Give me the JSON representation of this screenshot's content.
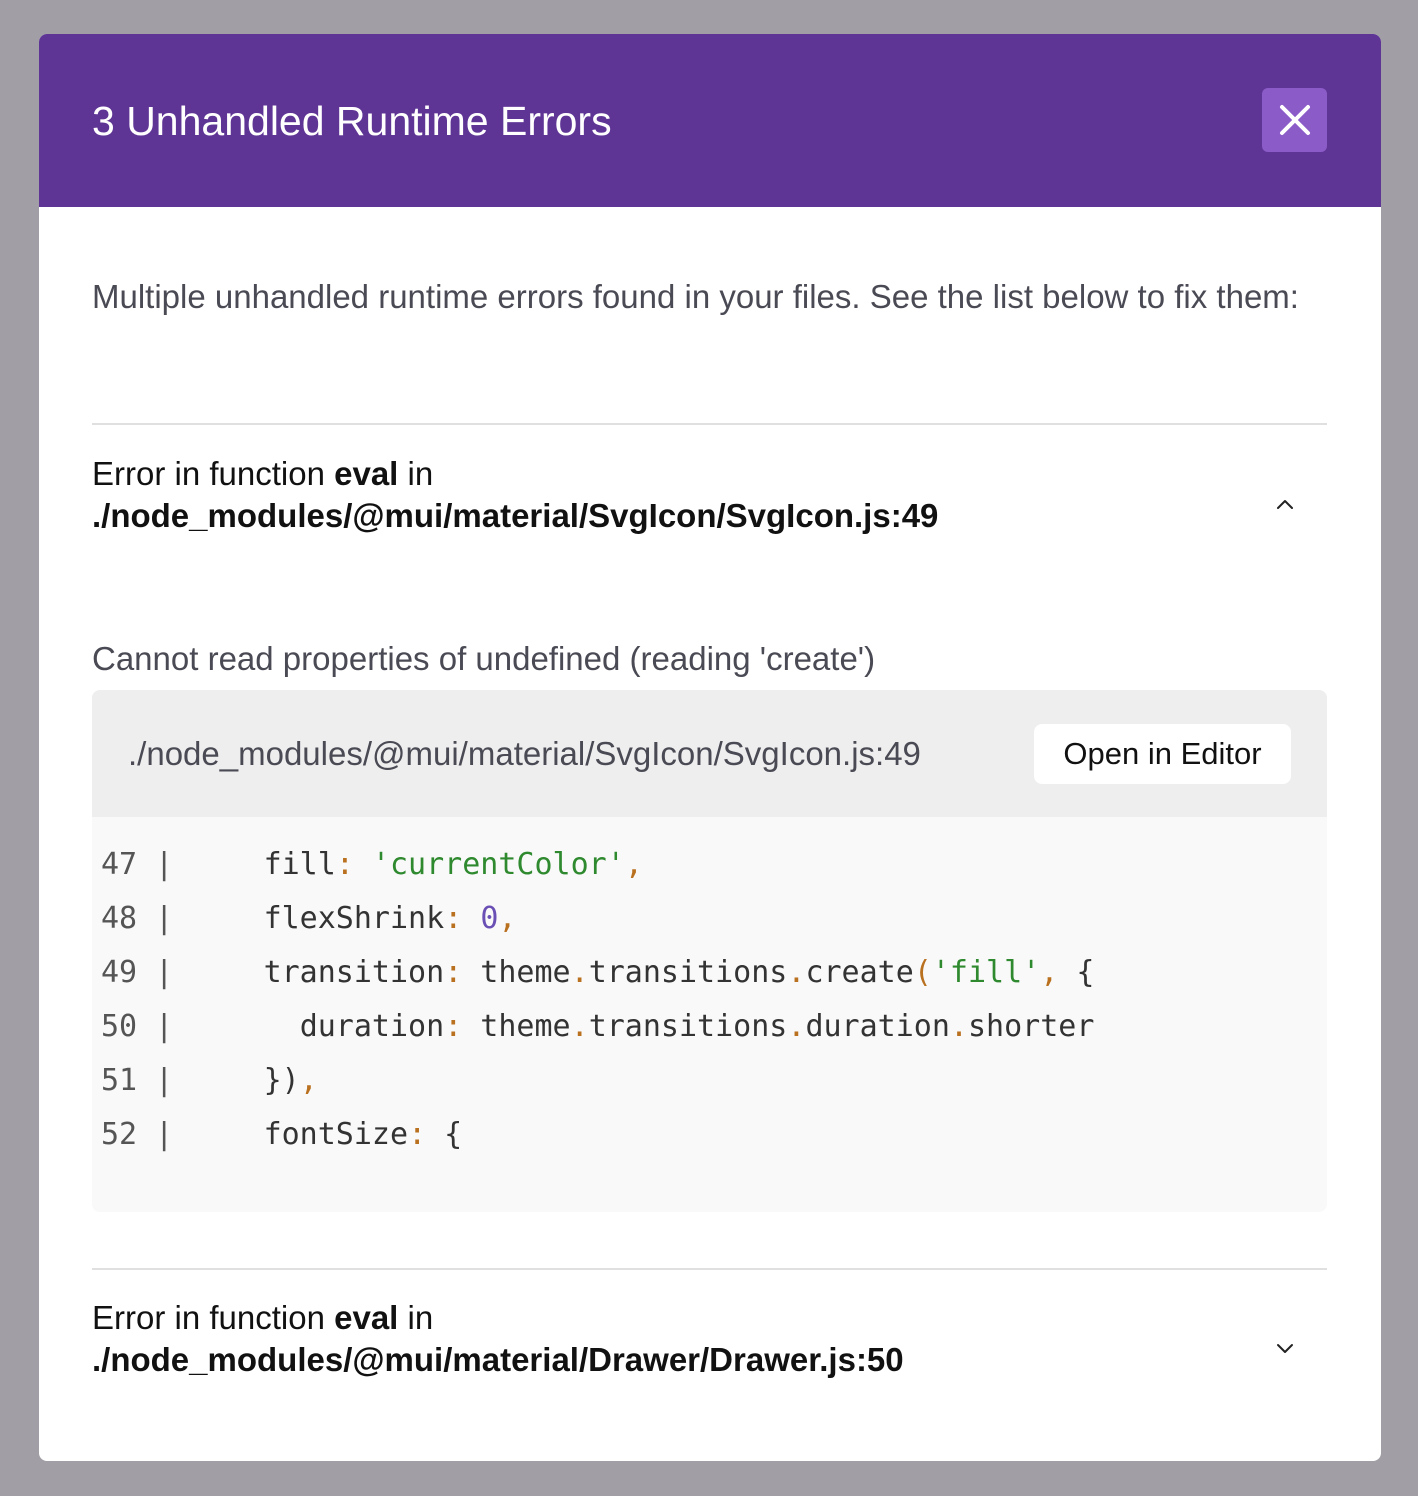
{
  "modal": {
    "title": "3 Unhandled Runtime Errors",
    "close_icon": "close-icon",
    "intro": "Multiple unhandled runtime errors found in your files. See the list below to fix them:"
  },
  "errors": [
    {
      "prefix": "Error in function ",
      "function": "eval",
      "infix": " in",
      "location": "./node_modules/@mui/material/SvgIcon/SvgIcon.js:49",
      "expanded": true,
      "toggle_icon": "chevron-up-icon",
      "message": "Cannot read properties of undefined (reading 'create')",
      "code_path": "./node_modules/@mui/material/SvgIcon/SvgIcon.js:49",
      "open_in_editor": "Open in Editor",
      "code_lines": [
        {
          "number": "47",
          "text": "    fill: 'currentColor',"
        },
        {
          "number": "48",
          "text": "    flexShrink: 0,"
        },
        {
          "number": "49",
          "text": "    transition: theme.transitions.create('fill', {"
        },
        {
          "number": "50",
          "text": "      duration: theme.transitions.duration.shorter"
        },
        {
          "number": "51",
          "text": "    }),"
        },
        {
          "number": "52",
          "text": "    fontSize: {"
        }
      ]
    },
    {
      "prefix": "Error in function ",
      "function": "eval",
      "infix": " in",
      "location": "./node_modules/@mui/material/Drawer/Drawer.js:50",
      "expanded": false,
      "toggle_icon": "chevron-down-icon"
    }
  ],
  "colors": {
    "header": "#5e3595",
    "close_button": "#8b5bc8",
    "backdrop": "#a19fa5",
    "punctuation": "#b9701f",
    "string": "#2f8a2f",
    "number": "#6a4fb5"
  }
}
